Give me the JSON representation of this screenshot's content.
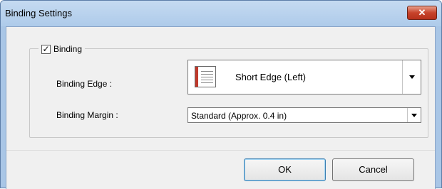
{
  "window": {
    "title": "Binding Settings",
    "close_icon": "close-icon"
  },
  "binding_group": {
    "checkbox_checked": true,
    "checkbox_label": "Binding"
  },
  "binding_edge": {
    "label": "Binding Edge :",
    "icon": "short-edge-left-binding-icon",
    "selected_value": "Short Edge (Left)"
  },
  "binding_margin": {
    "label": "Binding Margin :",
    "selected_value": "Standard (Approx. 0.4 in)"
  },
  "buttons": {
    "ok_label": "OK",
    "cancel_label": "Cancel"
  },
  "colors": {
    "titlebar": "#b9d1ea",
    "close_button": "#c7432b",
    "binding_edge_accent": "#c0392b"
  }
}
